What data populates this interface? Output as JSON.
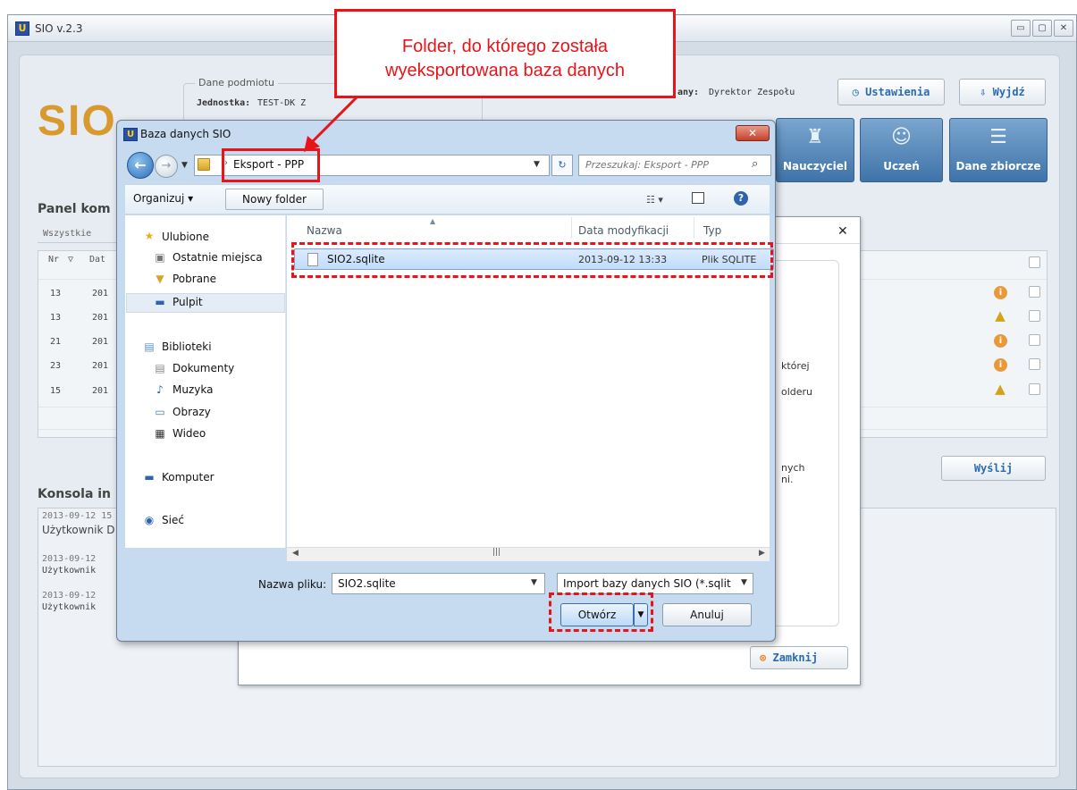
{
  "app": {
    "title": "SIO v.2.3",
    "icon_label": "U",
    "controls": [
      "▭",
      "▢",
      "✕"
    ]
  },
  "header": {
    "logo_text": "SIO",
    "entity_legend": "Dane podmiotu",
    "entity_label": "Jednostka:",
    "entity_value": "TEST-DK Z",
    "role_label": "any:",
    "role_value": "Dyrektor Zespołu",
    "settings_label": "Ustawienia",
    "exit_label": "Wyjdź",
    "modules": [
      "Nauczyciel",
      "Uczeń",
      "Dane zbiorcze"
    ]
  },
  "panel": {
    "title": "Panel kom",
    "tab_all": "Wszystkie",
    "col_nr": "Nr",
    "col_date": "Dat",
    "rows": [
      {
        "nr": "13",
        "date": "201",
        "status": "info"
      },
      {
        "nr": "13",
        "date": "201",
        "status": "warn"
      },
      {
        "nr": "21",
        "date": "201",
        "status": "info"
      },
      {
        "nr": "23",
        "date": "201",
        "status": "info"
      },
      {
        "nr": "15",
        "date": "201",
        "status": "warn"
      }
    ],
    "send_label": "Wyślij"
  },
  "console": {
    "title": "Konsola in",
    "entries": [
      {
        "ts": "2013-09-12 15",
        "msg": "Użytkownik D"
      },
      {
        "ts": "2013-09-12",
        "msg": "Użytkownik"
      },
      {
        "ts": "2013-09-12",
        "msg": "Użytkownik"
      }
    ]
  },
  "behind_dialog": {
    "text_1": "której",
    "text_2": "olderu",
    "text_3": "nych",
    "text_4": "ni.",
    "close_label": "Zamknij"
  },
  "file_dialog": {
    "title": "Baza danych SIO",
    "path": "Eksport - PPP",
    "search_placeholder": "Przeszukaj: Eksport - PPP",
    "organize_label": "Organizuj ▾",
    "new_folder_label": "Nowy folder",
    "nav": {
      "favorites": "Ulubione",
      "recent": "Ostatnie miejsca",
      "downloads": "Pobrane",
      "desktop": "Pulpit",
      "libraries": "Biblioteki",
      "documents": "Dokumenty",
      "music": "Muzyka",
      "pictures": "Obrazy",
      "video": "Wideo",
      "computer": "Komputer",
      "network": "Sieć"
    },
    "columns": {
      "name": "Nazwa",
      "date": "Data modyfikacji",
      "type": "Typ"
    },
    "files": [
      {
        "name": "SIO2.sqlite",
        "date": "2013-09-12 13:33",
        "type": "Plik SQLITE"
      }
    ],
    "filename_label": "Nazwa pliku:",
    "filename_value": "SIO2.sqlite",
    "filter_value": "Import bazy danych SIO (*.sqlit",
    "open_label": "Otwórz",
    "cancel_label": "Anuluj"
  },
  "annotation": {
    "callout_line1": "Folder, do którego została",
    "callout_line2": "wyeksportowana baza danych",
    "color": "#e8141a"
  }
}
